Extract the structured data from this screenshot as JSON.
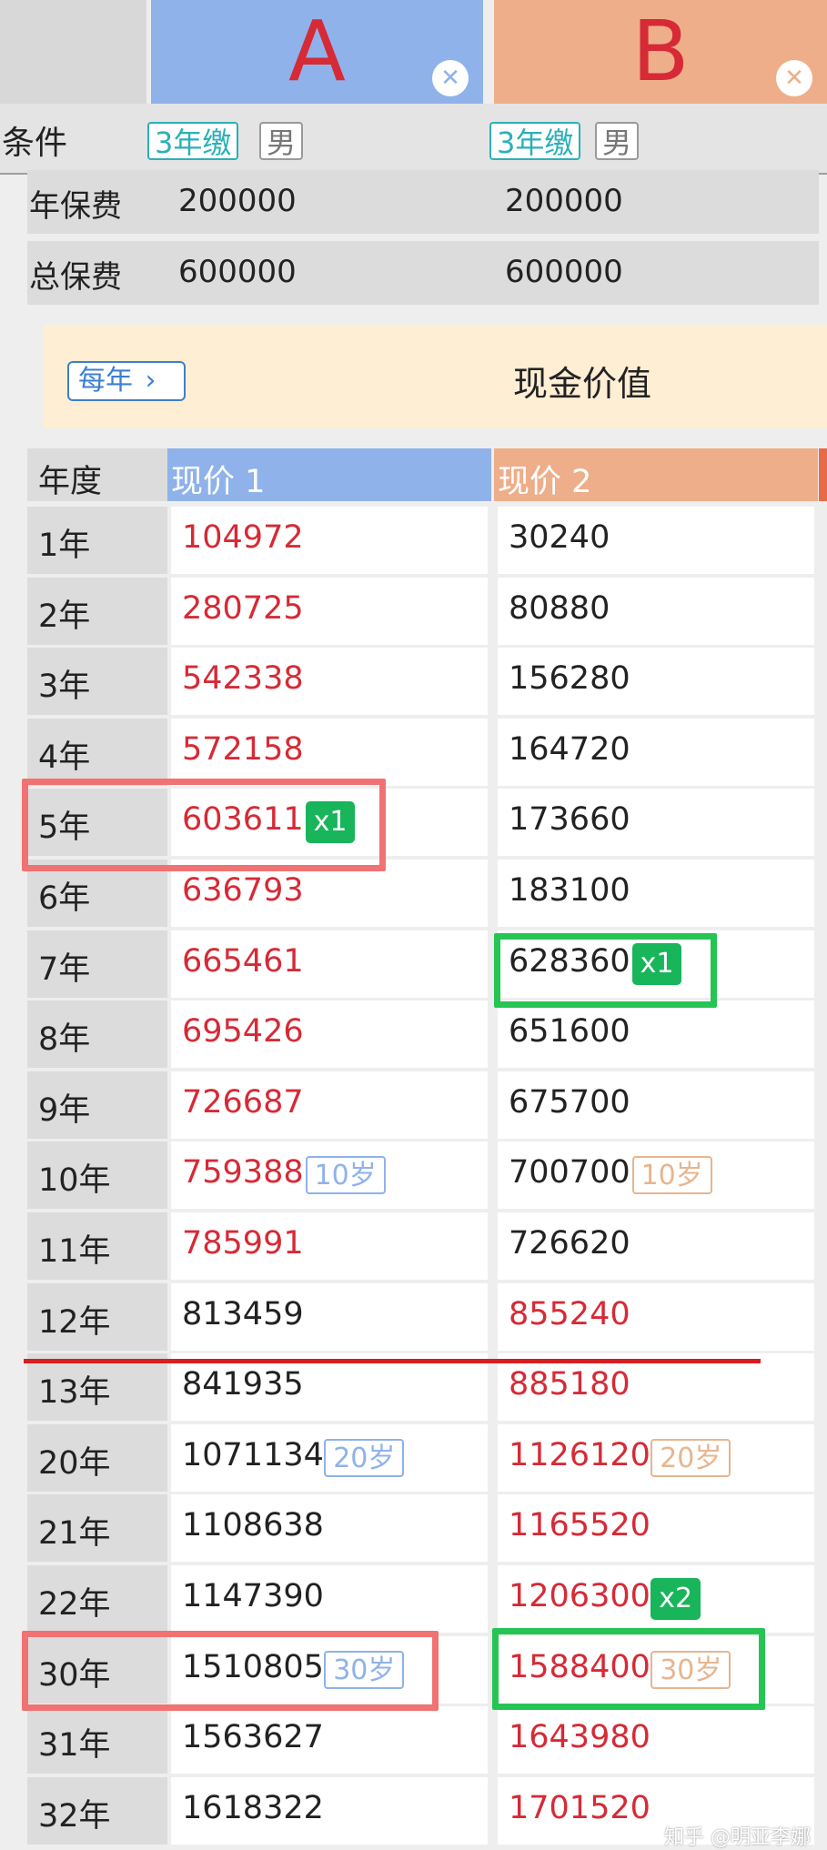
{
  "columns": {
    "a": {
      "letter": "A",
      "close_icon": "close-icon"
    },
    "b": {
      "letter": "B",
      "close_icon": "close-icon"
    }
  },
  "condition": {
    "label": "条件",
    "a": {
      "term": "3年缴",
      "gender": "男"
    },
    "b": {
      "term": "3年缴",
      "gender": "男"
    }
  },
  "premiums": {
    "annual": {
      "label": "年保费",
      "a": "200000",
      "b": "200000"
    },
    "total": {
      "label": "总保费",
      "a": "600000",
      "b": "600000"
    }
  },
  "banner": {
    "period_button": "每年",
    "chevron_icon": "chevron-right-icon",
    "title": "现金价值"
  },
  "table": {
    "headers": {
      "year": "年度",
      "a": "现价 1",
      "b": "现价 2"
    },
    "rows": [
      {
        "year": "1年",
        "a": "104972",
        "b": "30240"
      },
      {
        "year": "2年",
        "a": "280725",
        "b": "80880"
      },
      {
        "year": "3年",
        "a": "542338",
        "b": "156280"
      },
      {
        "year": "4年",
        "a": "572158",
        "b": "164720"
      },
      {
        "year": "5年",
        "a": "603611",
        "b": "173660",
        "a_badge": "x1"
      },
      {
        "year": "6年",
        "a": "636793",
        "b": "183100"
      },
      {
        "year": "7年",
        "a": "665461",
        "b": "628360",
        "b_badge": "x1"
      },
      {
        "year": "8年",
        "a": "695426",
        "b": "651600"
      },
      {
        "year": "9年",
        "a": "726687",
        "b": "675700"
      },
      {
        "year": "10年",
        "a": "759388",
        "b": "700700",
        "a_age": "10岁",
        "b_age": "10岁"
      },
      {
        "year": "11年",
        "a": "785991",
        "b": "726620"
      },
      {
        "year": "12年",
        "a": "813459",
        "b": "855240"
      },
      {
        "year": "13年",
        "a": "841935",
        "b": "885180"
      },
      {
        "year": "20年",
        "a": "1071134",
        "b": "1126120",
        "a_age": "20岁",
        "b_age": "20岁"
      },
      {
        "year": "21年",
        "a": "1108638",
        "b": "1165520"
      },
      {
        "year": "22年",
        "a": "1147390",
        "b": "1206300",
        "b_badge": "x2"
      },
      {
        "year": "30年",
        "a": "1510805",
        "b": "1588400",
        "a_age": "30岁",
        "b_age": "30岁"
      },
      {
        "year": "31年",
        "a": "1563627",
        "b": "1643980"
      },
      {
        "year": "32年",
        "a": "1618322",
        "b": "1701520"
      }
    ]
  },
  "colors": {
    "column_a": "#8fb2ea",
    "column_b": "#eeae8a",
    "higher_value_red": "#d62a36",
    "badge_green": "#18b55b",
    "term_tag": "#2bb0b8",
    "annotation_red": "#f07272",
    "annotation_green": "#26c453",
    "banner_bg": "#fdeed4"
  },
  "watermark": "知乎 @明亚李娜"
}
